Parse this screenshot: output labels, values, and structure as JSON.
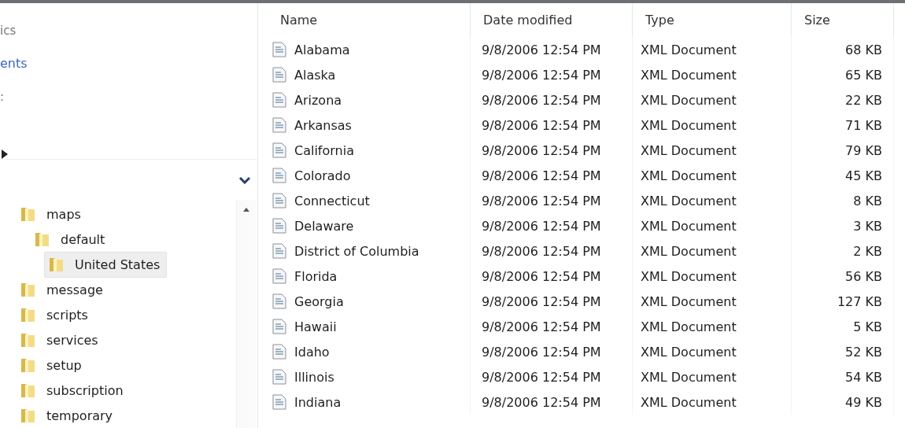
{
  "nav": {
    "items": [
      {
        "label": "ics",
        "kind": "plain"
      },
      {
        "label": "ents",
        "kind": "link"
      },
      {
        "label": ":",
        "kind": "plain"
      }
    ]
  },
  "tree": {
    "items": [
      {
        "label": "maps",
        "selected": false,
        "children": [
          {
            "label": "default",
            "selected": false,
            "children": [
              {
                "label": "United States",
                "selected": true
              }
            ]
          }
        ]
      },
      {
        "label": "message",
        "selected": false
      },
      {
        "label": "scripts",
        "selected": false
      },
      {
        "label": "services",
        "selected": false
      },
      {
        "label": "setup",
        "selected": false
      },
      {
        "label": "subscription",
        "selected": false
      },
      {
        "label": "temporary",
        "selected": false
      }
    ]
  },
  "table": {
    "columns": [
      "Name",
      "Date modified",
      "Type",
      "Size"
    ],
    "rows": [
      [
        "Alabama",
        "9/8/2006 12:54 PM",
        "XML Document",
        "68 KB"
      ],
      [
        "Alaska",
        "9/8/2006 12:54 PM",
        "XML Document",
        "65 KB"
      ],
      [
        "Arizona",
        "9/8/2006 12:54 PM",
        "XML Document",
        "22 KB"
      ],
      [
        "Arkansas",
        "9/8/2006 12:54 PM",
        "XML Document",
        "71 KB"
      ],
      [
        "California",
        "9/8/2006 12:54 PM",
        "XML Document",
        "79 KB"
      ],
      [
        "Colorado",
        "9/8/2006 12:54 PM",
        "XML Document",
        "45 KB"
      ],
      [
        "Connecticut",
        "9/8/2006 12:54 PM",
        "XML Document",
        "8 KB"
      ],
      [
        "Delaware",
        "9/8/2006 12:54 PM",
        "XML Document",
        "3 KB"
      ],
      [
        "District of Columbia",
        "9/8/2006 12:54 PM",
        "XML Document",
        "2 KB"
      ],
      [
        "Florida",
        "9/8/2006 12:54 PM",
        "XML Document",
        "56 KB"
      ],
      [
        "Georgia",
        "9/8/2006 12:54 PM",
        "XML Document",
        "127 KB"
      ],
      [
        "Hawaii",
        "9/8/2006 12:54 PM",
        "XML Document",
        "5 KB"
      ],
      [
        "Idaho",
        "9/8/2006 12:54 PM",
        "XML Document",
        "52 KB"
      ],
      [
        "Illinois",
        "9/8/2006 12:54 PM",
        "XML Document",
        "54 KB"
      ],
      [
        "Indiana",
        "9/8/2006 12:54 PM",
        "XML Document",
        "49 KB"
      ]
    ]
  }
}
